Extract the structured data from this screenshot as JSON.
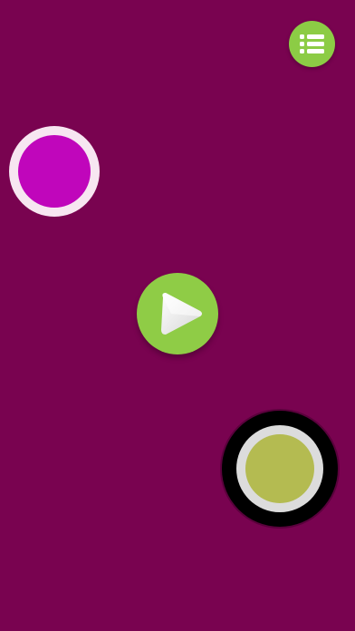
{
  "screen": {
    "background_color": "#790350"
  },
  "menu_button": {
    "icon": "list-icon",
    "color": "#8ccc45"
  },
  "play_button": {
    "icon": "play-icon",
    "color": "#8fcc46"
  },
  "balls": [
    {
      "name": "magenta-ball",
      "fill": "#c006bb",
      "ring": "#f7e6f1"
    },
    {
      "name": "olive-target",
      "fill": "#b4bb51",
      "ring": "#dcdcdc",
      "outer": "#000000"
    }
  ]
}
